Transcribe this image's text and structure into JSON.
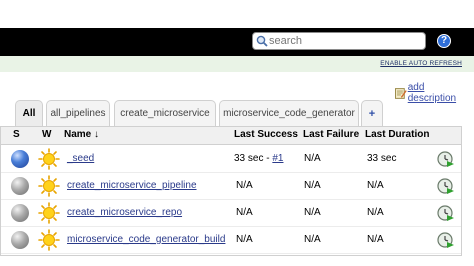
{
  "header": {
    "search_placeholder": "search",
    "help_label": "?"
  },
  "refresh": {
    "label": "ENABLE AUTO REFRESH"
  },
  "description": {
    "add_label": "add description"
  },
  "tabs": [
    {
      "label": "All",
      "active": true
    },
    {
      "label": "all_pipelines"
    },
    {
      "label": "create_microservice"
    },
    {
      "label": "microservice_code_generator"
    },
    {
      "label": "+"
    }
  ],
  "table": {
    "columns": {
      "s": "S",
      "w": "W",
      "name": "Name ↓",
      "last_success": "Last Success",
      "last_failure": "Last Failure",
      "last_duration": "Last Duration"
    },
    "rows": [
      {
        "status": "blue",
        "name": "_seed",
        "last_success_text": "33 sec - ",
        "last_success_link": "#1",
        "last_failure": "N/A",
        "last_duration": "33 sec"
      },
      {
        "status": "grey",
        "name": "create_microservice_pipeline",
        "last_success_text": "N/A",
        "last_success_link": "",
        "last_failure": "N/A",
        "last_duration": "N/A"
      },
      {
        "status": "grey",
        "name": "create_microservice_repo",
        "last_success_text": "N/A",
        "last_success_link": "",
        "last_failure": "N/A",
        "last_duration": "N/A"
      },
      {
        "status": "grey",
        "name": "microservice_code_generator_build",
        "last_success_text": "N/A",
        "last_success_link": "",
        "last_failure": "N/A",
        "last_duration": "N/A"
      }
    ]
  }
}
